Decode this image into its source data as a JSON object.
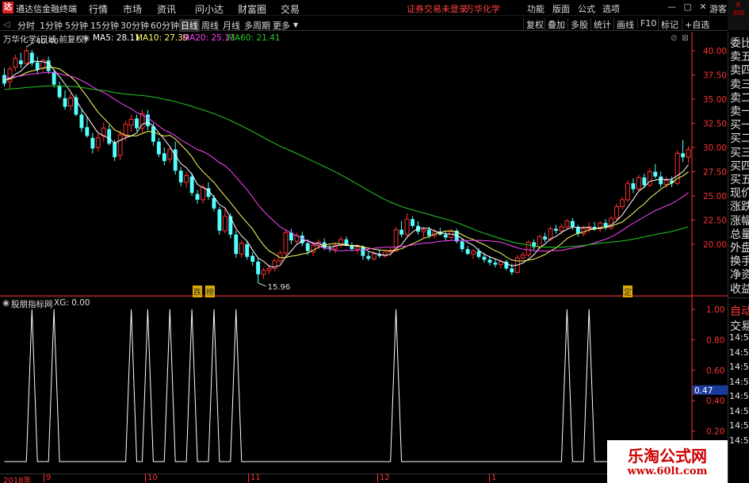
{
  "app_title": "通达信金融终端",
  "menu": [
    "行情",
    "市场",
    "资讯",
    "问小达",
    "财富圈",
    "交易"
  ],
  "notice": "证券交易未登录",
  "stock_title": "万华化学",
  "right_menu": [
    "功能",
    "版面",
    "公式",
    "选项"
  ],
  "guest": "游客",
  "rs_badge": [
    "R",
    "300"
  ],
  "periods": [
    "分时",
    "1分钟",
    "5分钟",
    "15分钟",
    "30分钟",
    "60分钟",
    "日线",
    "周线",
    "月线",
    "多周期",
    "更多"
  ],
  "active_period": "日线",
  "toolbar_right": [
    "复权",
    "叠加",
    "多股",
    "统计",
    "画线",
    "F10",
    "标记",
    "+自选"
  ],
  "chart_header": {
    "name": "万华化学(日线 前复权)",
    "ma5": "MA5: 28.11",
    "ma10": "MA10: 27.39",
    "ma20": "MA20: 25.13",
    "ma60": "MA60: 21.41"
  },
  "colors": {
    "up": "#ff3232",
    "down": "#54ffff",
    "ma5": "#ffffff",
    "ma10": "#ffff66",
    "ma20": "#ff44ff",
    "ma60": "#22cc22",
    "axis": "#ff3232"
  },
  "price_axis": [
    "40.00",
    "37.50",
    "35.00",
    "32.50",
    "30.00",
    "27.50",
    "25.00",
    "22.50",
    "20.00"
  ],
  "max_label": "40.40",
  "min_label": "15.96",
  "signal_labels": [
    "跌",
    "榜",
    "定"
  ],
  "sub_header": {
    "name": "股朋指标网",
    "xg": "XG: 0.00"
  },
  "sub_axis": [
    "1.00",
    "0.80",
    "0.60",
    "0.47",
    "0.40",
    "0.20"
  ],
  "sideboard_top": [
    "委比",
    "卖五",
    "卖四",
    "卖三",
    "卖二",
    "卖一",
    "买一",
    "买二",
    "买三",
    "买四",
    "买五",
    "现价",
    "涨跌",
    "涨幅",
    "总量",
    "外盘",
    "换手",
    "净资",
    "收益"
  ],
  "sideboard_bottom": [
    "自动",
    "交易",
    "14:56",
    "14:56",
    "14:56",
    "14:56",
    "14:56",
    "14:56",
    "14:56",
    "14:56"
  ],
  "date_axis": [
    "2018年",
    "9",
    "10",
    "11",
    "12",
    "1"
  ],
  "watermark": {
    "title": "乐淘公式网",
    "url": "www.60lt.com"
  },
  "chart_data": [
    {
      "type": "candlestick",
      "title": "万华化学(日线 前复权)",
      "ylim": [
        17.0,
        42.0
      ],
      "series_lines": [
        "MA5",
        "MA10",
        "MA20",
        "MA60"
      ],
      "candles_ohlc": [
        [
          37.5,
          38.2,
          36.3,
          36.6
        ],
        [
          36.8,
          38.4,
          36.0,
          38.1
        ],
        [
          38.3,
          39.6,
          37.9,
          39.2
        ],
        [
          39.0,
          39.8,
          38.2,
          38.6
        ],
        [
          38.7,
          40.4,
          38.5,
          40.0
        ],
        [
          39.8,
          40.1,
          38.4,
          38.7
        ],
        [
          38.8,
          39.4,
          37.6,
          38.0
        ],
        [
          38.2,
          39.2,
          37.8,
          39.0
        ],
        [
          39.0,
          39.4,
          37.6,
          37.9
        ],
        [
          37.8,
          38.1,
          36.2,
          36.5
        ],
        [
          36.4,
          36.8,
          35.0,
          35.2
        ],
        [
          35.1,
          35.9,
          33.9,
          34.2
        ],
        [
          34.3,
          35.6,
          33.8,
          35.1
        ],
        [
          35.2,
          35.5,
          33.2,
          33.4
        ],
        [
          33.4,
          33.9,
          31.6,
          32.0
        ],
        [
          32.1,
          33.2,
          31.0,
          31.2
        ],
        [
          31.0,
          31.5,
          29.4,
          29.9
        ],
        [
          30.0,
          31.4,
          29.6,
          31.0
        ],
        [
          31.2,
          32.6,
          30.6,
          32.0
        ],
        [
          31.9,
          32.3,
          30.2,
          30.4
        ],
        [
          30.5,
          30.8,
          28.6,
          29.0
        ],
        [
          29.2,
          31.8,
          28.7,
          31.3
        ],
        [
          31.2,
          32.8,
          30.7,
          32.4
        ],
        [
          32.3,
          33.4,
          31.6,
          32.9
        ],
        [
          33.0,
          33.4,
          31.7,
          32.0
        ],
        [
          32.0,
          33.9,
          31.5,
          33.5
        ],
        [
          33.4,
          33.9,
          31.8,
          32.2
        ],
        [
          32.2,
          32.5,
          30.2,
          30.6
        ],
        [
          30.6,
          31.0,
          29.0,
          29.3
        ],
        [
          29.4,
          30.0,
          28.2,
          28.6
        ],
        [
          28.8,
          30.1,
          28.4,
          29.8
        ],
        [
          29.8,
          30.6,
          27.2,
          27.6
        ],
        [
          27.6,
          28.0,
          26.0,
          26.4
        ],
        [
          26.4,
          27.5,
          25.8,
          27.1
        ],
        [
          27.0,
          27.4,
          25.0,
          25.3
        ],
        [
          25.2,
          25.6,
          24.2,
          24.6
        ],
        [
          24.6,
          26.2,
          24.2,
          25.9
        ],
        [
          25.8,
          26.4,
          24.6,
          24.9
        ],
        [
          24.8,
          25.1,
          23.4,
          23.7
        ],
        [
          23.6,
          23.9,
          21.0,
          21.4
        ],
        [
          21.4,
          23.7,
          21.1,
          22.9
        ],
        [
          22.9,
          23.2,
          20.6,
          21.0
        ],
        [
          21.0,
          21.4,
          18.6,
          19.0
        ],
        [
          19.0,
          20.4,
          18.6,
          20.1
        ],
        [
          20.0,
          20.3,
          18.4,
          18.7
        ],
        [
          18.8,
          19.2,
          17.8,
          18.2
        ],
        [
          18.2,
          18.5,
          16.0,
          16.9
        ],
        [
          16.9,
          17.6,
          16.4,
          17.3
        ],
        [
          17.3,
          17.9,
          16.9,
          17.5
        ],
        [
          17.5,
          18.6,
          17.2,
          18.3
        ],
        [
          18.3,
          19.4,
          18.0,
          19.1
        ],
        [
          19.1,
          21.5,
          18.8,
          21.2
        ],
        [
          21.2,
          21.6,
          20.0,
          20.4
        ],
        [
          20.3,
          21.2,
          19.9,
          20.9
        ],
        [
          20.9,
          21.3,
          19.8,
          20.1
        ],
        [
          20.1,
          20.5,
          18.9,
          19.3
        ],
        [
          19.2,
          20.2,
          18.8,
          19.9
        ],
        [
          19.9,
          20.5,
          19.5,
          20.2
        ],
        [
          20.2,
          20.6,
          19.4,
          19.6
        ],
        [
          19.6,
          19.9,
          19.2,
          19.5
        ],
        [
          19.5,
          20.1,
          19.1,
          19.9
        ],
        [
          19.9,
          20.8,
          19.6,
          20.5
        ],
        [
          20.5,
          20.8,
          19.8,
          19.9
        ],
        [
          19.9,
          20.2,
          19.3,
          19.5
        ],
        [
          19.5,
          19.9,
          19.0,
          19.7
        ],
        [
          19.7,
          19.9,
          18.4,
          18.8
        ],
        [
          18.8,
          19.2,
          18.3,
          18.5
        ],
        [
          18.5,
          19.3,
          18.3,
          19.0
        ],
        [
          19.0,
          19.5,
          18.6,
          18.8
        ],
        [
          18.8,
          19.3,
          18.6,
          19.2
        ],
        [
          19.2,
          19.6,
          18.8,
          19.3
        ],
        [
          19.3,
          21.8,
          19.2,
          21.5
        ],
        [
          21.5,
          22.4,
          20.7,
          21.0
        ],
        [
          21.0,
          23.2,
          20.7,
          22.6
        ],
        [
          22.6,
          22.9,
          21.7,
          21.9
        ],
        [
          21.9,
          22.4,
          21.0,
          21.3
        ],
        [
          21.3,
          21.8,
          20.7,
          21.5
        ],
        [
          21.5,
          21.8,
          20.6,
          20.9
        ],
        [
          20.9,
          21.6,
          20.6,
          21.3
        ],
        [
          21.3,
          21.7,
          20.9,
          21.0
        ],
        [
          21.0,
          21.3,
          20.4,
          20.7
        ],
        [
          20.7,
          21.6,
          20.5,
          21.4
        ],
        [
          21.4,
          21.6,
          20.1,
          20.3
        ],
        [
          20.3,
          20.6,
          19.2,
          19.5
        ],
        [
          19.5,
          19.8,
          18.9,
          19.0
        ],
        [
          19.0,
          19.5,
          18.5,
          19.3
        ],
        [
          19.3,
          19.6,
          18.5,
          18.7
        ],
        [
          18.7,
          19.1,
          18.1,
          18.4
        ],
        [
          18.4,
          18.8,
          17.8,
          18.1
        ],
        [
          18.1,
          18.5,
          17.6,
          17.9
        ],
        [
          17.9,
          18.4,
          17.5,
          18.2
        ],
        [
          18.2,
          18.4,
          17.3,
          17.5
        ],
        [
          17.5,
          18.0,
          16.8,
          17.1
        ],
        [
          17.1,
          18.9,
          17.0,
          18.6
        ],
        [
          18.6,
          19.2,
          18.4,
          18.9
        ],
        [
          18.9,
          20.4,
          18.7,
          20.2
        ],
        [
          20.2,
          20.5,
          19.4,
          19.7
        ],
        [
          19.7,
          21.0,
          19.5,
          20.8
        ],
        [
          20.8,
          21.2,
          20.2,
          20.5
        ],
        [
          20.5,
          21.9,
          20.3,
          21.6
        ],
        [
          21.6,
          22.0,
          21.1,
          21.4
        ],
        [
          21.4,
          22.1,
          21.0,
          21.8
        ],
        [
          21.8,
          22.6,
          21.5,
          22.4
        ],
        [
          22.4,
          22.7,
          21.5,
          21.8
        ],
        [
          21.8,
          22.0,
          20.8,
          21.1
        ],
        [
          21.1,
          21.9,
          20.8,
          21.6
        ],
        [
          21.6,
          22.3,
          21.2,
          21.8
        ],
        [
          21.8,
          22.3,
          21.4,
          21.6
        ],
        [
          21.6,
          22.4,
          21.3,
          22.2
        ],
        [
          22.2,
          22.6,
          21.5,
          21.7
        ],
        [
          21.7,
          22.9,
          21.5,
          22.7
        ],
        [
          22.7,
          24.2,
          22.5,
          23.9
        ],
        [
          23.9,
          24.9,
          23.6,
          24.6
        ],
        [
          24.6,
          26.6,
          24.4,
          26.3
        ],
        [
          26.3,
          26.8,
          25.3,
          25.7
        ],
        [
          25.7,
          27.2,
          25.5,
          26.9
        ],
        [
          26.9,
          27.3,
          25.8,
          26.1
        ],
        [
          26.1,
          27.9,
          25.9,
          27.5
        ],
        [
          27.5,
          28.3,
          26.8,
          27.0
        ],
        [
          27.0,
          27.5,
          25.9,
          26.2
        ],
        [
          26.2,
          27.0,
          25.8,
          26.6
        ],
        [
          26.6,
          27.0,
          25.9,
          26.3
        ],
        [
          26.3,
          29.7,
          26.1,
          29.4
        ],
        [
          29.4,
          30.8,
          28.5,
          29.0
        ],
        [
          29.0,
          30.1,
          28.4,
          29.8
        ]
      ]
    },
    {
      "type": "line",
      "title": "股朋指标网",
      "ylim": [
        0,
        1.0
      ],
      "spike_candle_index": [
        5,
        9,
        23,
        26,
        30,
        34,
        38,
        42,
        71,
        102,
        106
      ]
    }
  ]
}
